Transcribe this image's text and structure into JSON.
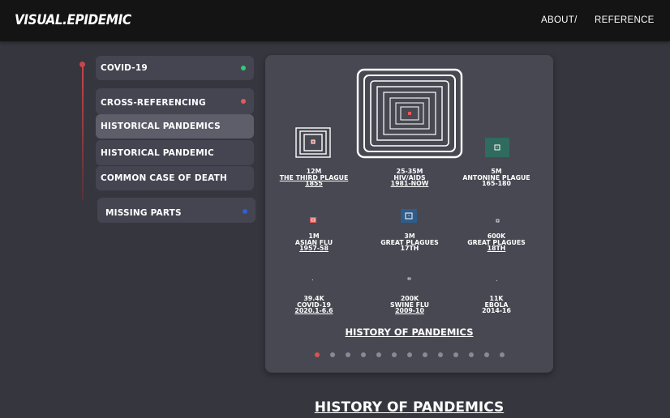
{
  "header": {
    "logo": "VISUAL.EPIDEMIC",
    "nav": [
      {
        "label": "ABOUT/"
      },
      {
        "label": "REFERENCE"
      }
    ]
  },
  "sidebar": {
    "items": [
      {
        "label": "COVID-19",
        "dot_color": "#2ecc71"
      },
      {
        "label": "CROSS-REFERENCING",
        "dot_color": "#e05b5b"
      },
      {
        "label": "HISTORICAL PANDEMICS"
      },
      {
        "label": "HISTORICAL PANDEMIC"
      },
      {
        "label": "COMMON CASE OF DEATH"
      },
      {
        "label": "MISSING PARTS",
        "dot_color": "#2d5fd6"
      }
    ]
  },
  "card": {
    "cells": [
      {
        "count": "12M",
        "name": "THE THIRD PLAGUE",
        "years": "1855"
      },
      {
        "count": "25-35M",
        "name": "HIV/AIDS",
        "years": "1981-NOW"
      },
      {
        "count": "5M",
        "name": "ANTONINE PLAGUE",
        "years": "165-180"
      },
      {
        "count": "1M",
        "name": "ASIAN FLU",
        "years": "1957-58"
      },
      {
        "count": "3M",
        "name": "GREAT PLAGUES",
        "years": "17TH"
      },
      {
        "count": "600K",
        "name": "GREAT PLAGUES",
        "years": "18TH"
      },
      {
        "count": "39.4K",
        "name": "COVID-19",
        "years": "2020.1-6.6"
      },
      {
        "count": "200K",
        "name": "SWINE FLU",
        "years": "2009-10"
      },
      {
        "count": "11K",
        "name": "EBOLA",
        "years": "2014-16"
      }
    ],
    "title": "HISTORY OF PANDEMICS",
    "pager": {
      "total": 13,
      "current": 1
    }
  },
  "section_title": "HISTORY OF PANDEMICS",
  "colors": {
    "accent": "#d9534f",
    "teal": "#2f6b5e",
    "blue": "#2f5d8a"
  }
}
